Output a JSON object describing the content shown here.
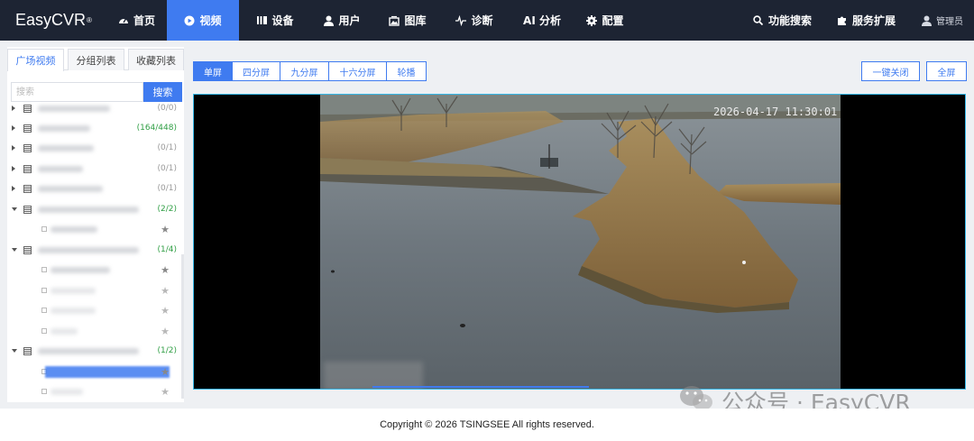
{
  "brand": {
    "name": "EasyCVR",
    "mark": "®"
  },
  "nav": {
    "items": [
      {
        "label": "首页",
        "icon": "dashboard-icon"
      },
      {
        "label": "视频",
        "icon": "play-circle-icon",
        "active": true
      },
      {
        "label": "设备",
        "icon": "device-icon"
      },
      {
        "label": "用户",
        "icon": "user-icon"
      },
      {
        "label": "图库",
        "icon": "gallery-icon"
      },
      {
        "label": "诊断",
        "icon": "pulse-icon"
      },
      {
        "label": "AI 分析",
        "icon": ""
      },
      {
        "label": "配置",
        "icon": "gear-icon"
      }
    ],
    "right": [
      {
        "label": "功能搜索",
        "icon": "search-icon"
      },
      {
        "label": "服务扩展",
        "icon": "puzzle-icon"
      }
    ],
    "admin": "管理员",
    "accent": "#3f7bf0",
    "background": "#1d2433"
  },
  "sidebar": {
    "tabs": [
      "广场视频",
      "分组列表",
      "收藏列表"
    ],
    "active_tab": 0,
    "search": {
      "placeholder": "搜索",
      "button": "搜索"
    },
    "tree": [
      {
        "kind": "group",
        "expanded": false,
        "count": "(0/0)",
        "partial": true
      },
      {
        "kind": "group",
        "expanded": false,
        "count": "(164/448)",
        "online": true
      },
      {
        "kind": "group",
        "expanded": false,
        "count": "(0/1)"
      },
      {
        "kind": "group",
        "expanded": false,
        "count": "(0/1)"
      },
      {
        "kind": "group",
        "expanded": false,
        "count": "(0/1)"
      },
      {
        "kind": "group",
        "expanded": true,
        "count": "(2/2)",
        "online": true
      },
      {
        "kind": "channel",
        "star": "dark"
      },
      {
        "kind": "group",
        "expanded": true,
        "count": "(1/4)",
        "online": true
      },
      {
        "kind": "channel",
        "star": "dark"
      },
      {
        "kind": "channel",
        "star": "pale"
      },
      {
        "kind": "channel",
        "star": "pale"
      },
      {
        "kind": "channel",
        "star": "pale"
      },
      {
        "kind": "group",
        "expanded": true,
        "count": "(1/2)",
        "online": true
      },
      {
        "kind": "channel",
        "star": "dark",
        "selected": true
      },
      {
        "kind": "channel",
        "star": "pale"
      }
    ]
  },
  "toolbar": {
    "splits": [
      "单屏",
      "四分屏",
      "九分屏",
      "十六分屏",
      "轮播"
    ],
    "active_split": 0,
    "close_all": "一键关闭",
    "fullscreen": "全屏"
  },
  "player": {
    "timestamp": "2026-04-17 11:30:01"
  },
  "footer": {
    "copyright": "Copyright © 2026 TSINGSEE All rights reserved."
  },
  "watermark": {
    "text": "公众号 · EasyCVR",
    "icon": "wechat-icon"
  }
}
